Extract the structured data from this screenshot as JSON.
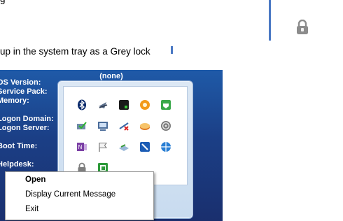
{
  "doc": {
    "line_top": "g",
    "line_system_tray": "up in the system tray as a Grey lock"
  },
  "screen": {
    "none_label": "(none)",
    "labels": [
      "OS Version:",
      "Service Pack:",
      "Memory:",
      "",
      "Logon Domain:",
      "Logon Server:",
      "",
      "Boot Time:",
      "",
      "Helpdesk:"
    ]
  },
  "tray": {
    "icons": [
      "bluetooth-icon",
      "network-icon",
      "terminal-icon",
      "orange-circle-icon",
      "green-shield-icon",
      "green-check-icon",
      "monitor-icon",
      "network-cross-icon",
      "disk-icon",
      "spiral-icon",
      "onenote-icon",
      "flag-icon",
      "scanner-icon",
      "blue-tool-icon",
      "blue-globe-icon",
      "grey-lock-icon",
      "green-app-icon"
    ]
  },
  "context_menu": {
    "items": [
      {
        "label": "Open",
        "bold": true
      },
      {
        "label": "Display Current Message",
        "bold": false
      },
      {
        "label": "Exit",
        "bold": false
      }
    ]
  },
  "colors": {
    "screen_bg": "#1f5aa8",
    "tray_panel": "#dce8f5",
    "accent_bar": "#4a78c4"
  }
}
